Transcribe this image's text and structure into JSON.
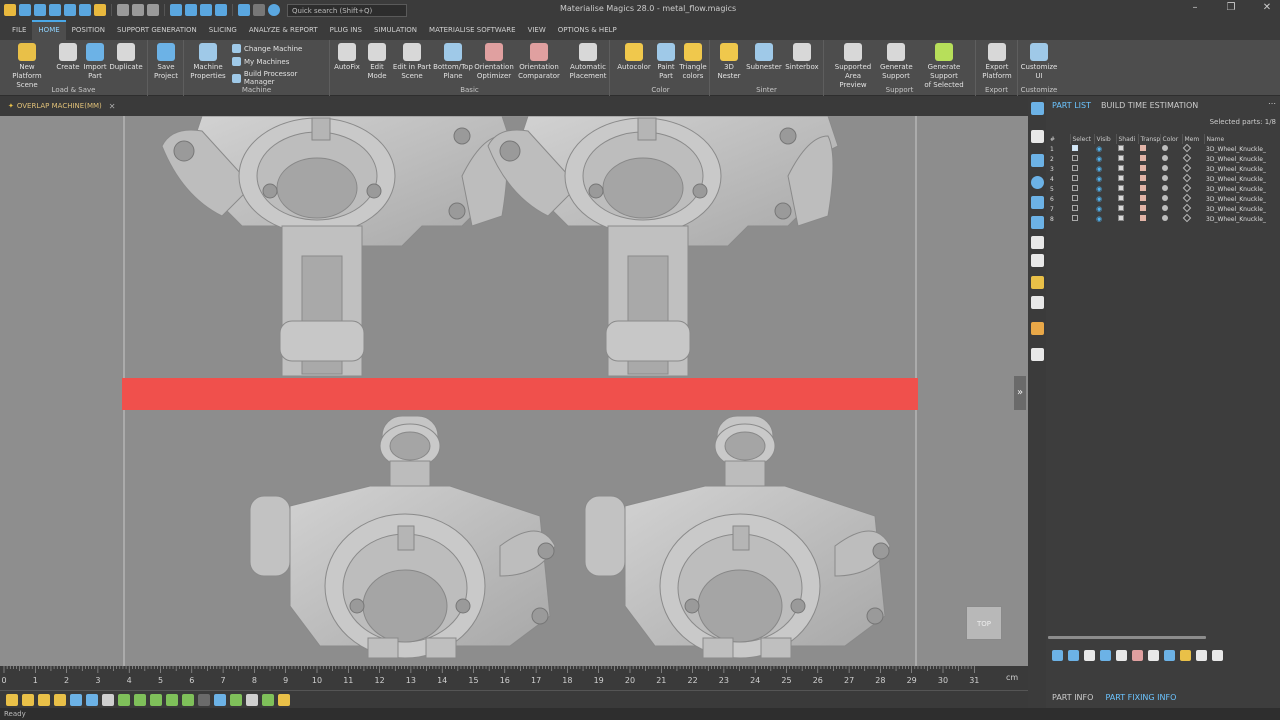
{
  "title_bar": {
    "window_title": "Materialise Magics 28.0 - metal_flow.magics",
    "search_placeholder": "Quick search (Shift+Q)",
    "min_symbol": "–",
    "max_symbol": "❐",
    "close_symbol": "✕"
  },
  "menu_tabs": [
    "FILE",
    "HOME",
    "POSITION",
    "SUPPORT GENERATION",
    "SLICING",
    "ANALYZE & REPORT",
    "PLUG INS",
    "SIMULATION",
    "MATERIALISE SOFTWARE",
    "VIEW",
    "OPTIONS & HELP"
  ],
  "active_tab": "HOME",
  "ribbon": {
    "groups": [
      "Load & Save",
      "Machine",
      "Basic",
      "Color",
      "Sinter",
      "Support",
      "Export",
      "Customize"
    ],
    "buttons": {
      "new_platform": [
        "New Platform",
        "Scene"
      ],
      "create": [
        "Create",
        ""
      ],
      "import": [
        "Import",
        "Part"
      ],
      "duplicate": [
        "Duplicate",
        ""
      ],
      "save": [
        "Save",
        "Project"
      ],
      "machine_props": [
        "Machine",
        "Properties"
      ],
      "autofix": [
        "AutoFix",
        ""
      ],
      "edit_mode": [
        "Edit",
        "Mode"
      ],
      "edit_in_part": [
        "Edit in Part",
        "Scene"
      ],
      "bottom_top": [
        "Bottom/Top",
        "Plane"
      ],
      "orientation_opt": [
        "Orientation",
        "Optimizer"
      ],
      "orientation_cmp": [
        "Orientation",
        "Comparator"
      ],
      "auto_place": [
        "Automatic",
        "Placement"
      ],
      "autocolor": [
        "Autocolor",
        ""
      ],
      "paint_part": [
        "Paint",
        "Part"
      ],
      "triangle_colors": [
        "Triangle",
        "colors"
      ],
      "nester_3d": [
        "3D",
        "Nester"
      ],
      "subnester": [
        "Subnester",
        ""
      ],
      "sinterbox": [
        "Sinterbox",
        ""
      ],
      "supported_area": [
        "Supported Area",
        "Preview"
      ],
      "generate_support": [
        "Generate",
        "Support"
      ],
      "generate_support_sel": [
        "Generate Support",
        "of Selected"
      ],
      "export_platform": [
        "Export",
        "Platform"
      ],
      "customize_ui": [
        "Customize",
        "UI"
      ]
    },
    "machine_small": [
      "Change Machine",
      "My Machines",
      "Build Processor Manager"
    ]
  },
  "scene_tab": "OVERLAP MACHINE(MM)",
  "viewcube_label": "TOP",
  "ruler": {
    "unit": "cm",
    "labels": [
      "0",
      "1",
      "2",
      "3",
      "4",
      "5",
      "6",
      "7",
      "8",
      "9",
      "10",
      "11",
      "12",
      "13",
      "14",
      "15",
      "16",
      "17",
      "18",
      "19",
      "20",
      "21",
      "22",
      "23",
      "24",
      "25",
      "26",
      "27",
      "28",
      "29",
      "30",
      "31"
    ]
  },
  "status": "Ready",
  "right_panel": {
    "tabs": [
      "PART LIST",
      "BUILD TIME ESTIMATION"
    ],
    "selected_parts": "Selected parts: 1/8",
    "columns": [
      "#",
      "Select",
      "Visib",
      "Shadi",
      "Transp",
      "Color",
      "Mem",
      "Name"
    ],
    "rows": [
      {
        "num": "1",
        "selected": true,
        "name": "3D_Wheel_Knuckle_"
      },
      {
        "num": "2",
        "selected": false,
        "name": "3D_Wheel_Knuckle_"
      },
      {
        "num": "3",
        "selected": false,
        "name": "3D_Wheel_Knuckle_"
      },
      {
        "num": "4",
        "selected": false,
        "name": "3D_Wheel_Knuckle_"
      },
      {
        "num": "5",
        "selected": false,
        "name": "3D_Wheel_Knuckle_"
      },
      {
        "num": "6",
        "selected": false,
        "name": "3D_Wheel_Knuckle_"
      },
      {
        "num": "7",
        "selected": false,
        "name": "3D_Wheel_Knuckle_"
      },
      {
        "num": "8",
        "selected": false,
        "name": "3D_Wheel_Knuckle_"
      }
    ],
    "bottom_tabs": [
      "PART INFO",
      "PART FIXING INFO"
    ]
  },
  "colors": {
    "accent": "#4aa8e8",
    "overlap_band": "#f0504c",
    "viewport_bg": "#8d8d8d",
    "part_gray": "#c4c4c4"
  },
  "icons": [
    "search-icon",
    "save-icon",
    "undo-icon",
    "redo-icon",
    "wrench-icon",
    "eye-icon",
    "cube-icon",
    "text-abc-icon",
    "paperclip-icon",
    "layers-icon",
    "collapse-arrow-icon"
  ]
}
